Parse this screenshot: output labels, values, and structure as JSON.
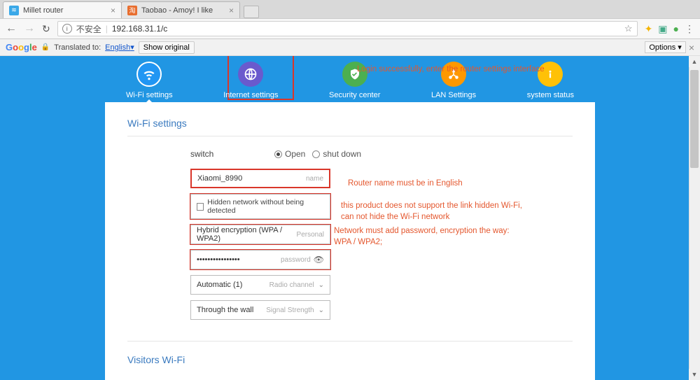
{
  "window": {
    "min": "—",
    "max": "▢",
    "close": "✕"
  },
  "tabs": [
    {
      "title": "Millet router",
      "favicon": "≋"
    },
    {
      "title": "Taobao - Amoy! I like",
      "favicon": "淘"
    }
  ],
  "urlbar": {
    "back": "←",
    "fwd": "→",
    "reload": "↻",
    "insecure": "不安全",
    "url": "192.168.31.1/c",
    "star": "☆"
  },
  "ext": {
    "e1": "✦",
    "e2": "▣",
    "e3": "●",
    "e4": "⋮"
  },
  "translate": {
    "google": {
      "g1": "G",
      "g2": "o",
      "g3": "o",
      "g4": "g",
      "g5": "l",
      "g6": "e"
    },
    "translated_to": "Translated to:",
    "lang": "English",
    "show_original": "Show original",
    "options": "Options",
    "close": "×"
  },
  "nav": {
    "wifi": "Wi-Fi settings",
    "internet": "Internet settings",
    "security": "Security center",
    "lan": "LAN Settings",
    "status": "system status"
  },
  "card": {
    "title": "Wi-Fi settings",
    "switch_label": "switch",
    "radio_open": "Open",
    "radio_shut": "shut down",
    "name_value": "Xiaomi_8990",
    "name_hint": "name",
    "hidden_label": "Hidden network without being detected",
    "encryption_value": "Hybrid encryption (WPA / WPA2)",
    "encryption_hint": "Personal",
    "password_value": "••••••••••••••••",
    "password_hint": "password",
    "channel_value": "Automatic (1)",
    "channel_hint": "Radio channel",
    "signal_value": "Through the wall",
    "signal_hint": "Signal Strength",
    "visitors_title": "Visitors Wi-Fi"
  },
  "annot": {
    "top": "Login successfully, enter the router settings interface",
    "name": "Router name must be in English",
    "hidden": "this product does not support the link hidden Wi-Fi, can not hide the Wi-Fi network",
    "enc": "Network must add password, encryption the way: WPA / WPA2;"
  }
}
